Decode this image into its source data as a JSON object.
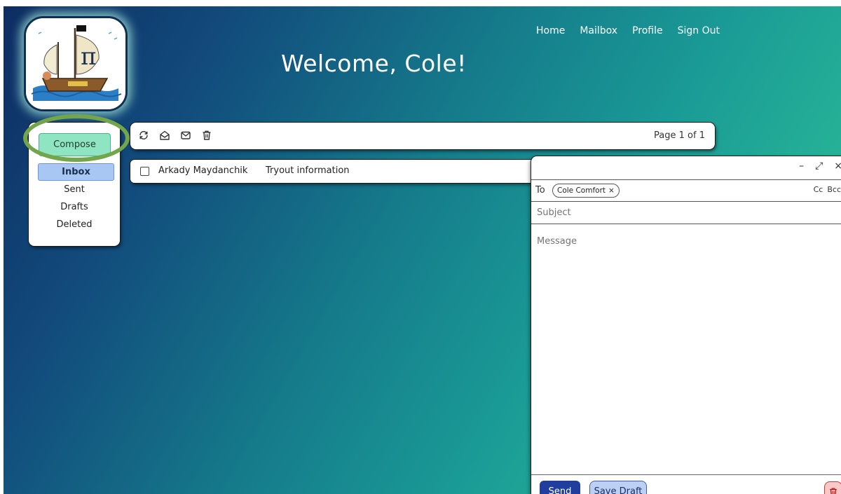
{
  "header": {
    "welcome_text": "Welcome, Cole!",
    "nav": [
      "Home",
      "Mailbox",
      "Profile",
      "Sign Out"
    ]
  },
  "sidebar": {
    "compose_label": "Compose",
    "folders": [
      {
        "label": "Inbox",
        "active": true
      },
      {
        "label": "Sent",
        "active": false
      },
      {
        "label": "Drafts",
        "active": false
      },
      {
        "label": "Deleted",
        "active": false
      }
    ]
  },
  "toolbar": {
    "icons": [
      "refresh-icon",
      "mark-read-icon",
      "mark-unread-icon",
      "trash-icon"
    ],
    "page_info": "Page 1 of 1"
  },
  "messages": [
    {
      "sender": "Arkady Maydanchik",
      "subject": "Tryout information"
    }
  ],
  "compose": {
    "window_controls": [
      "minimize-icon",
      "expand-icon",
      "close-icon"
    ],
    "to_label": "To",
    "recipient": "Cole Comfort",
    "cc_label": "Cc",
    "bcc_label": "Bcc",
    "subject_placeholder": "Subject",
    "message_placeholder": "Message",
    "send_label": "Send",
    "save_draft_label": "Save Draft"
  },
  "colors": {
    "compose_button": "#8fe5c2",
    "active_folder": "#a8c7f3",
    "send_button": "#1f3e9e",
    "save_draft_button": "#bcd0f4",
    "highlight_ring": "#73a64a"
  }
}
